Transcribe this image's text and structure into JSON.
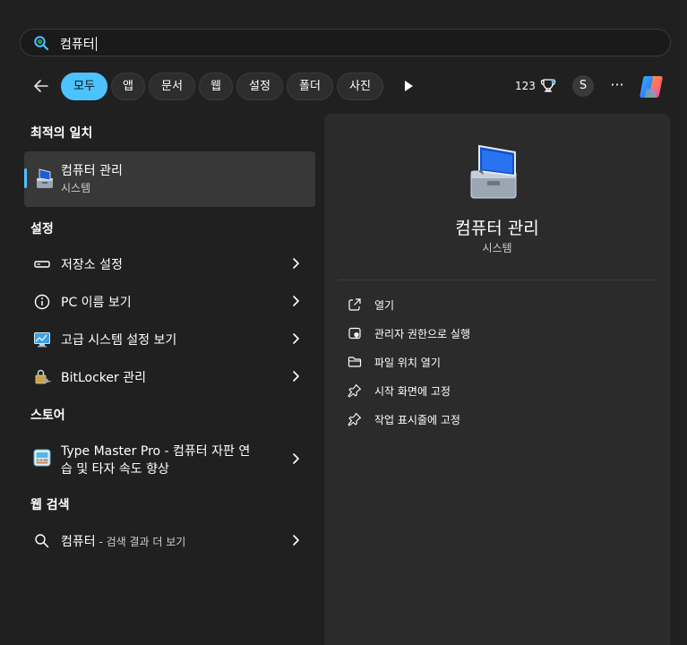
{
  "search": {
    "query": "컴퓨터"
  },
  "filters": {
    "chips": [
      "모두",
      "앱",
      "문서",
      "웹",
      "설정",
      "폴더",
      "사진"
    ],
    "active_index": 0,
    "points": "123",
    "avatar_initial": "S",
    "more_label": "···"
  },
  "best_match": {
    "heading": "최적의 일치",
    "title": "컴퓨터 관리",
    "subtitle": "시스템",
    "icon": "computer-management-icon"
  },
  "settings": {
    "heading": "설정",
    "items": [
      {
        "label": "저장소 설정",
        "icon": "storage-icon"
      },
      {
        "label": "PC 이름 보기",
        "icon": "info-icon"
      },
      {
        "label": "고급 시스템 설정 보기",
        "icon": "system-monitor-icon"
      },
      {
        "label": "BitLocker 관리",
        "icon": "bitlocker-key-icon"
      }
    ]
  },
  "store": {
    "heading": "스토어",
    "item": {
      "line1": "Type Master Pro - 컴퓨터 자판 연",
      "line2": "습 및 타자 속도 향상",
      "icon": "typing-app-icon"
    }
  },
  "web": {
    "heading": "웹 검색",
    "item": {
      "label": "컴퓨터",
      "suffix": " - 검색 결과 더 보기",
      "icon": "search-icon"
    }
  },
  "preview": {
    "title": "컴퓨터 관리",
    "subtitle": "시스템",
    "actions": [
      {
        "label": "열기",
        "icon": "open-external-icon"
      },
      {
        "label": "관리자 권한으로 실행",
        "icon": "shield-admin-icon"
      },
      {
        "label": "파일 위치 열기",
        "icon": "folder-icon"
      },
      {
        "label": "시작 화면에 고정",
        "icon": "pin-icon"
      },
      {
        "label": "작업 표시줄에 고정",
        "icon": "pin-icon"
      }
    ]
  },
  "colors": {
    "accent": "#4cc2ff",
    "background": "#202020",
    "panel": "#2b2b2b"
  }
}
